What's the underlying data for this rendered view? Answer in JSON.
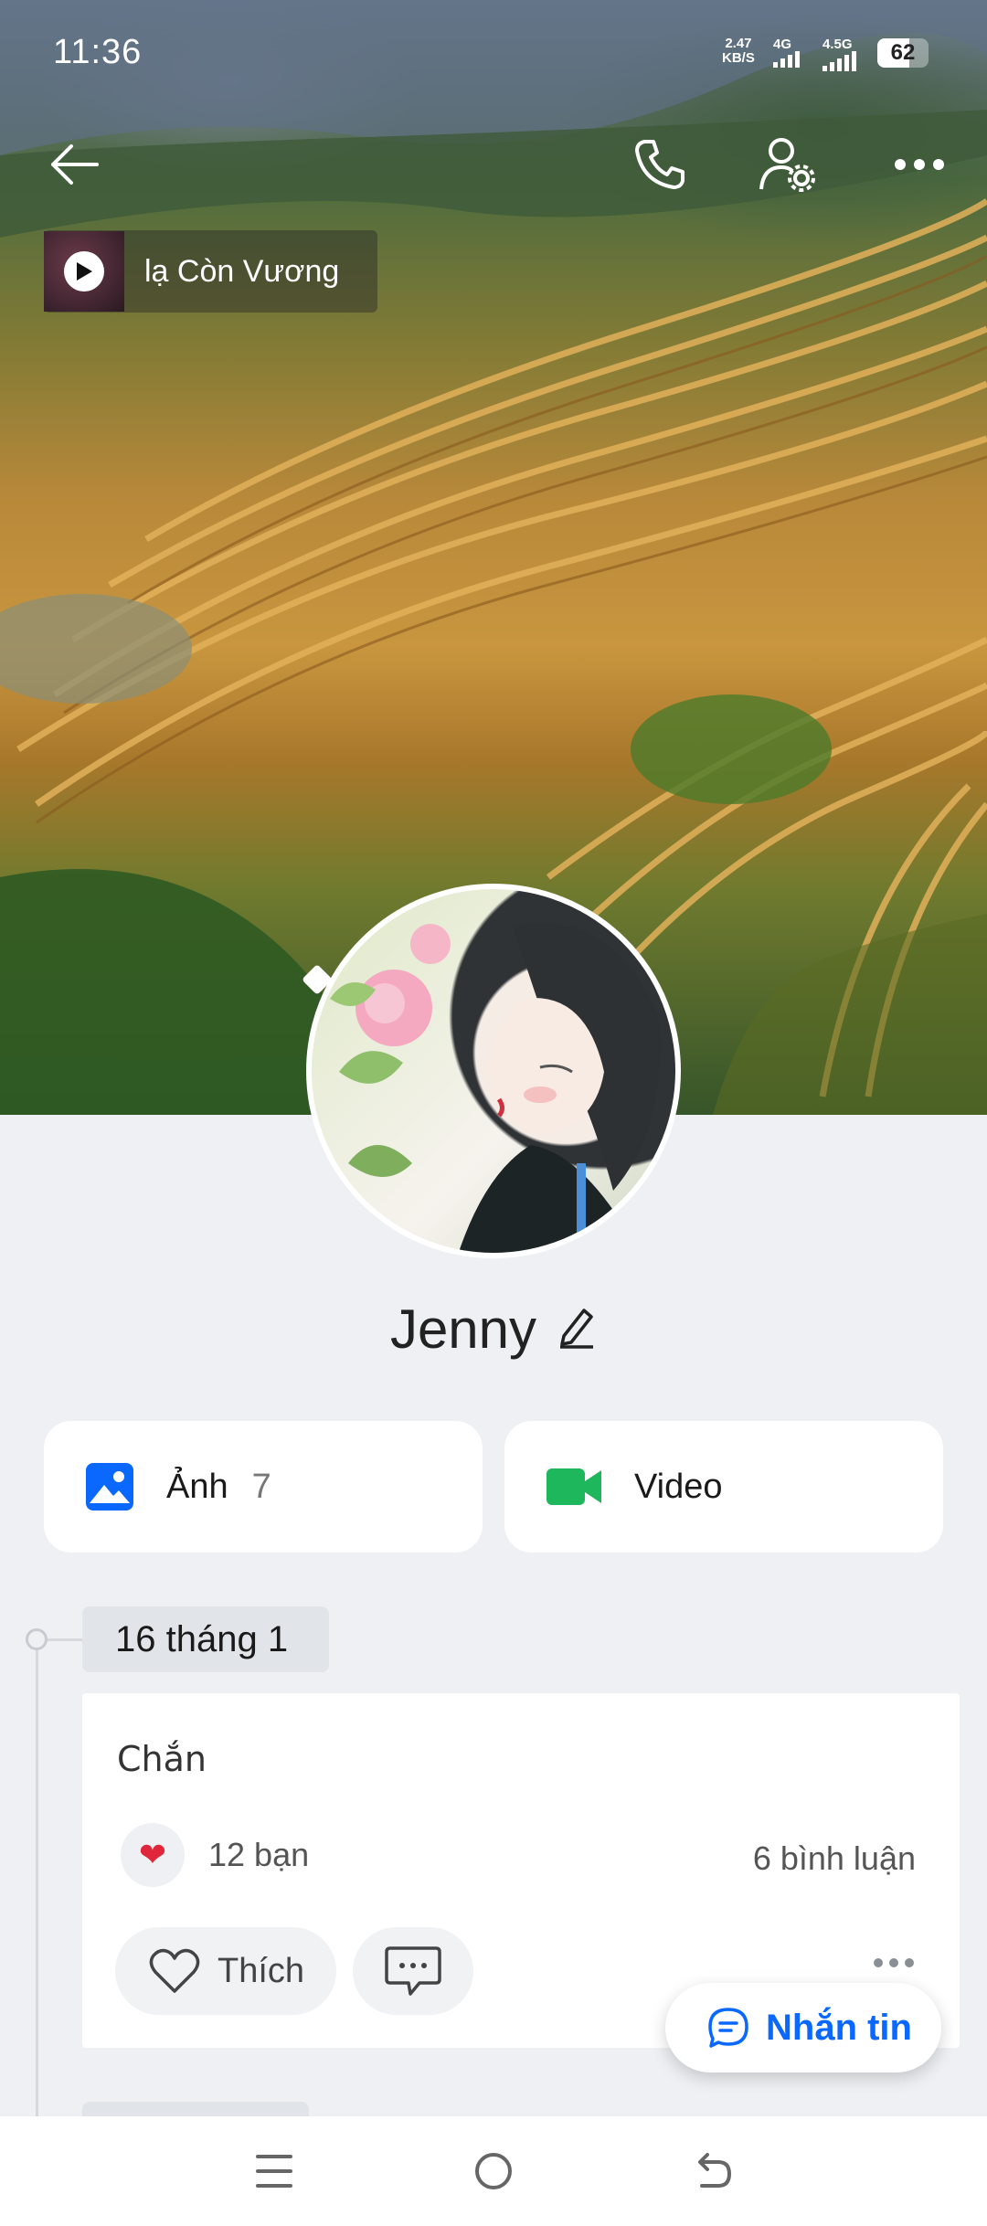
{
  "status_bar": {
    "time": "11:36",
    "net_speed_value": "2.47",
    "net_speed_unit": "KB/S",
    "signal1_label": "4G",
    "signal2_label": "4.5G",
    "battery": "62"
  },
  "header": {
    "icons": [
      "back-arrow-icon",
      "phone-icon",
      "user-settings-icon",
      "more-icon"
    ]
  },
  "music": {
    "title": "lạ Còn Vương"
  },
  "profile": {
    "name": "Jenny"
  },
  "media_cards": {
    "photos_label": "Ảnh",
    "photos_count": "7",
    "video_label": "Video"
  },
  "timeline": {
    "date": "16 tháng 1",
    "post": {
      "text": "Chắn",
      "reaction_count": "12 bạn",
      "comments": "6 bình luận",
      "like_label": "Thích"
    }
  },
  "fab": {
    "label": "Nhắn tin"
  },
  "colors": {
    "accent": "#0a68ff",
    "video_icon": "#1fb75b",
    "photo_icon": "#0a68ff",
    "background": "#eef0f3"
  }
}
